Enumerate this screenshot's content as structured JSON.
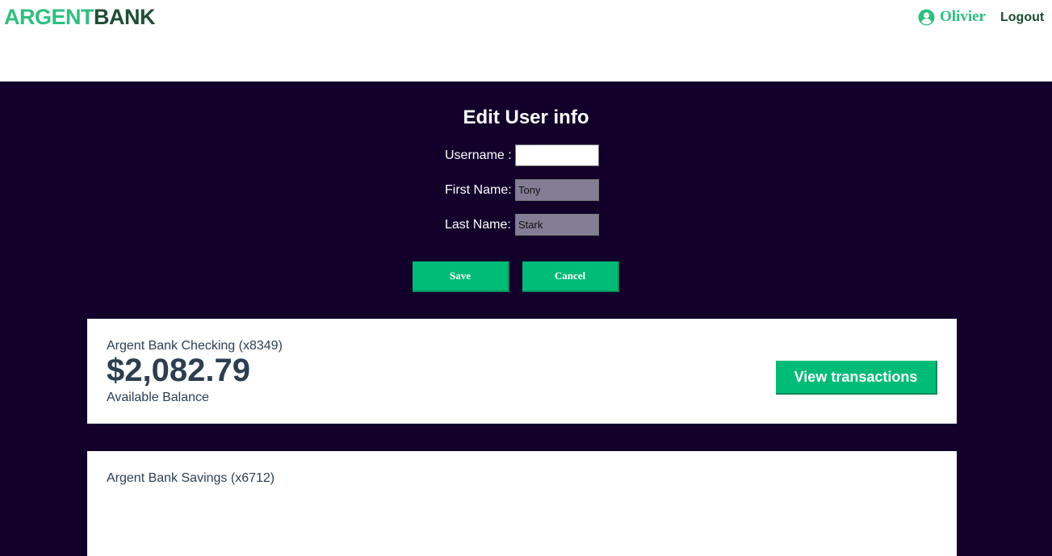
{
  "nav": {
    "logo_part1": "ARGENT",
    "logo_part2": "BANK",
    "user_name": "Olivier",
    "logout_label": "Logout"
  },
  "edit": {
    "title": "Edit User info",
    "username_label": "Username :",
    "username_value": "",
    "firstname_label": "First Name:",
    "firstname_value": "Tony",
    "lastname_label": "Last Name:",
    "lastname_value": "Stark",
    "save_label": "Save",
    "cancel_label": "Cancel"
  },
  "accounts": [
    {
      "title": "Argent Bank Checking (x8349)",
      "amount": "$2,082.79",
      "description": "Available Balance",
      "button_label": "View transactions"
    },
    {
      "title": "Argent Bank Savings (x6712)"
    }
  ],
  "colors": {
    "accent": "#00bc77",
    "background": "#12002b",
    "brand_dark": "#1d4d33",
    "brand_light": "#2ebf7f"
  },
  "icons": {
    "user": "user-circle-icon"
  }
}
